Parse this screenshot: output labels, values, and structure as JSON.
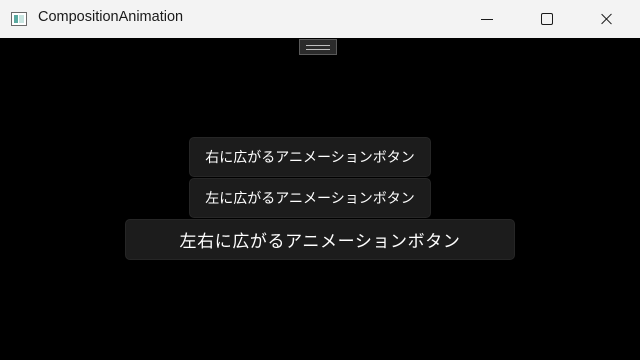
{
  "window": {
    "title": "CompositionAnimation",
    "controls": {
      "minimize_icon": "minimize-icon",
      "maximize_icon": "maximize-icon",
      "close_icon": "close-icon"
    }
  },
  "debug_toolbar": {
    "icon": "in-app-toolbar-handle-icon"
  },
  "buttons": {
    "expand_right": "右に広がるアニメーションボタン",
    "expand_left": "左に広がるアニメーションボタン",
    "expand_both": "左右に広がるアニメーションボタン"
  },
  "colors": {
    "background": "#000000",
    "titlebar": "#f3f3f3",
    "button_fill": "#1c1c1c",
    "button_text": "#ffffff"
  }
}
